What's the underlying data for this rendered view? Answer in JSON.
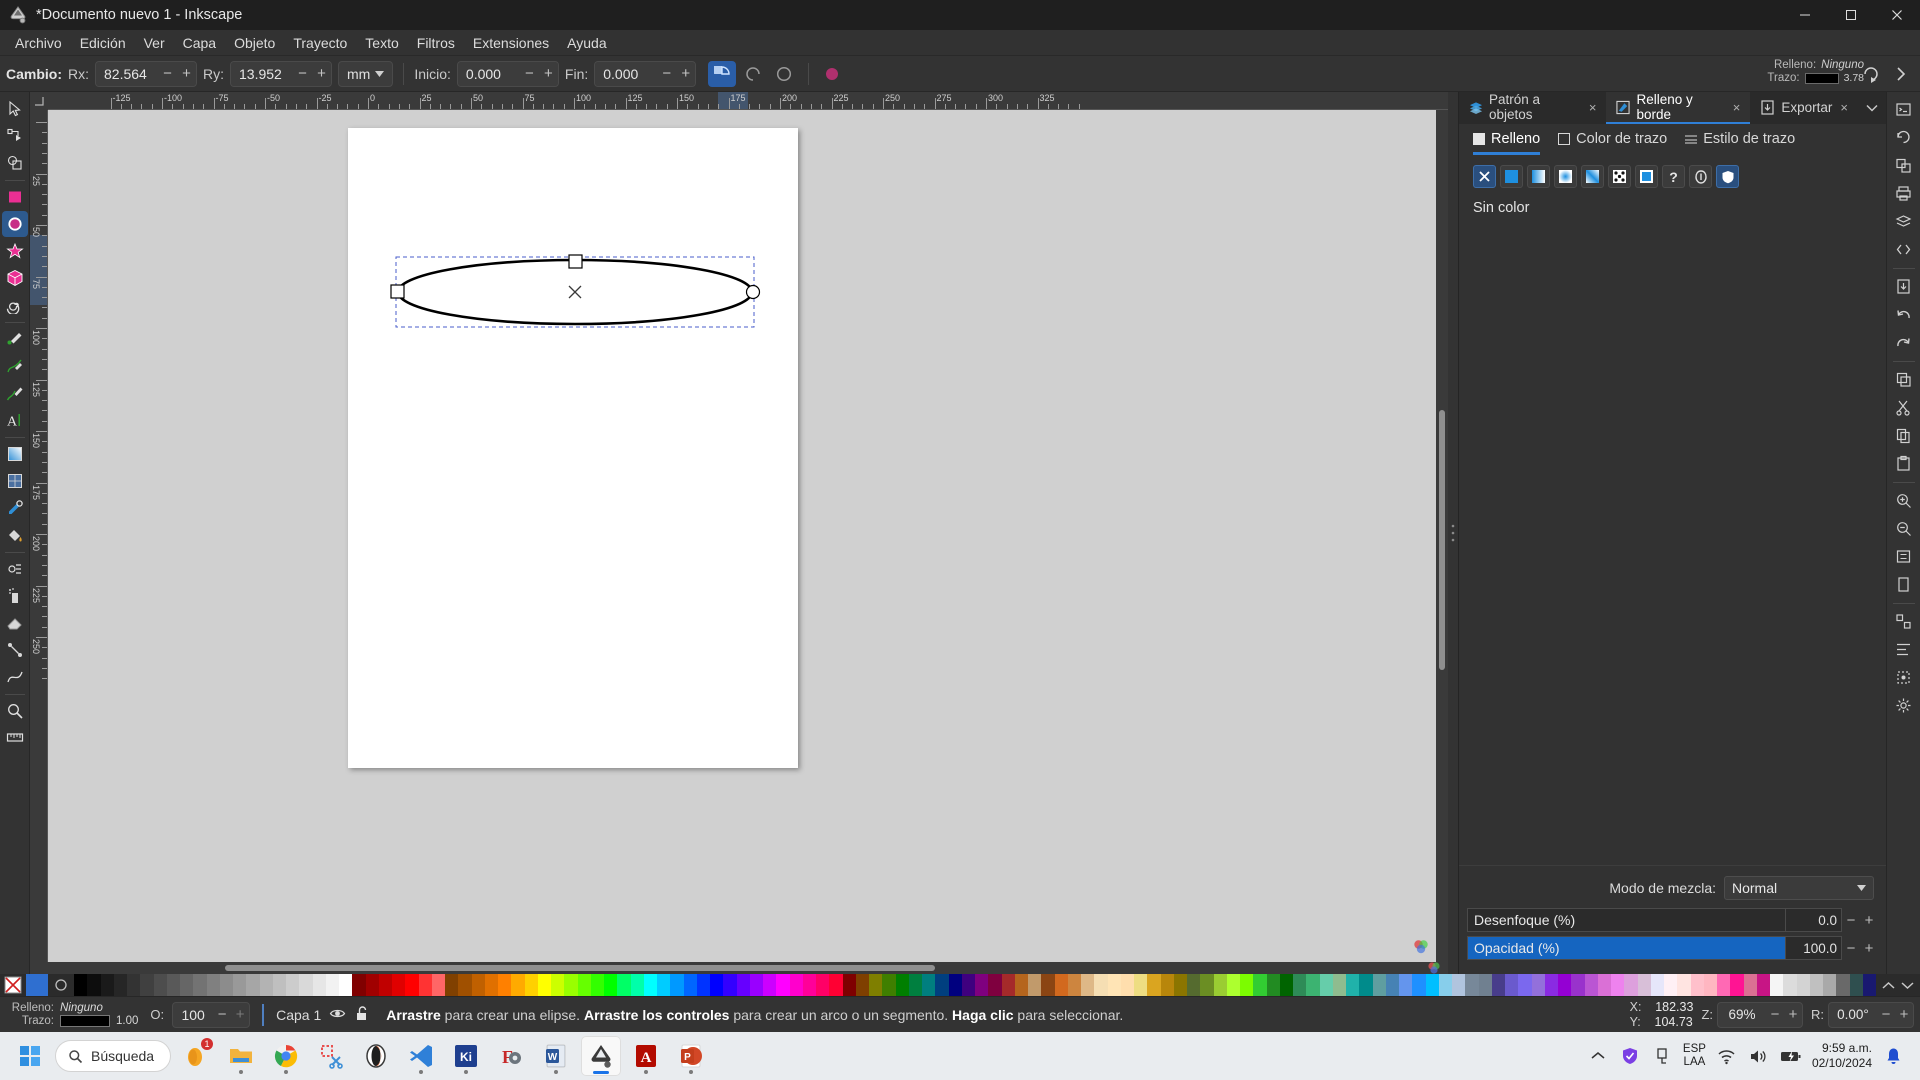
{
  "window": {
    "title": "*Documento nuevo 1 - Inkscape",
    "minimize": "minimize-icon",
    "maximize": "maximize-icon",
    "close": "close-icon"
  },
  "menu": {
    "items": [
      {
        "label": "Archivo"
      },
      {
        "label": "Edición"
      },
      {
        "label": "Ver"
      },
      {
        "label": "Capa"
      },
      {
        "label": "Objeto"
      },
      {
        "label": "Trayecto"
      },
      {
        "label": "Texto"
      },
      {
        "label": "Filtros"
      },
      {
        "label": "Extensiones"
      },
      {
        "label": "Ayuda"
      }
    ]
  },
  "toolopts": {
    "change_label": "Cambio:",
    "rx_label": "Rx:",
    "rx_value": "82.564",
    "ry_label": "Ry:",
    "ry_value": "13.952",
    "unit": "mm",
    "start_label": "Inicio:",
    "start_value": "0.000",
    "end_label": "Fin:",
    "end_value": "0.000",
    "minus": "−",
    "plus": "+",
    "modes": [
      {
        "name": "arc-slice-mode",
        "active": true
      },
      {
        "name": "arc-open-mode",
        "active": false
      },
      {
        "name": "ellipse-whole-mode",
        "active": false
      }
    ],
    "reset_button": "reset-shape-icon",
    "fill_label": "Relleno:",
    "fill_value": "Ninguno",
    "stroke_label": "Trazo:",
    "stroke_width": "3.78"
  },
  "toolbox": {
    "tools": [
      {
        "name": "selector-tool",
        "icon": "arrow-cursor-icon",
        "selected": false
      },
      {
        "name": "node-tool",
        "icon": "node-editor-icon",
        "selected": false
      },
      {
        "name": "boolean-tool",
        "icon": "boolean-ops-icon",
        "selected": false
      },
      {
        "name": "rectangle-tool",
        "icon": "rectangle-icon",
        "selected": false
      },
      {
        "name": "ellipse-tool",
        "icon": "ellipse-icon",
        "selected": true
      },
      {
        "name": "star-tool",
        "icon": "star-icon",
        "selected": false
      },
      {
        "name": "box3d-tool",
        "icon": "3d-box-icon",
        "selected": false
      },
      {
        "name": "spiral-tool",
        "icon": "spiral-icon",
        "selected": false
      },
      {
        "name": "pencil-tool",
        "icon": "pencil-icon",
        "selected": false
      },
      {
        "name": "pen-tool",
        "icon": "bezier-pen-icon",
        "selected": false
      },
      {
        "name": "calligraphy-tool",
        "icon": "calligraphy-brush-icon",
        "selected": false
      },
      {
        "name": "text-tool",
        "icon": "text-a-icon",
        "selected": false
      },
      {
        "name": "gradient-tool",
        "icon": "gradient-icon",
        "selected": false
      },
      {
        "name": "mesh-tool",
        "icon": "mesh-gradient-icon",
        "selected": false
      },
      {
        "name": "dropper-tool",
        "icon": "eyedropper-icon",
        "selected": false
      },
      {
        "name": "paintbucket-tool",
        "icon": "paint-bucket-icon",
        "selected": false
      },
      {
        "name": "tweak-tool",
        "icon": "tweak-icon",
        "selected": false
      },
      {
        "name": "spray-tool",
        "icon": "spray-can-icon",
        "selected": false
      },
      {
        "name": "eraser-tool",
        "icon": "eraser-icon",
        "selected": false
      },
      {
        "name": "connector-tool",
        "icon": "connector-icon",
        "selected": false
      },
      {
        "name": "lpe-tool",
        "icon": "path-effect-icon",
        "selected": false
      },
      {
        "name": "zoom-tool",
        "icon": "magnifier-icon",
        "selected": false
      },
      {
        "name": "measure-tool",
        "icon": "measure-ruler-icon",
        "selected": false
      }
    ]
  },
  "rulers": {
    "horizontal_labels": [
      "-125",
      "-100",
      "-75",
      "-50",
      "-25",
      "0",
      "25",
      "50",
      "75",
      "100",
      "125",
      "150",
      "175",
      "200",
      "225",
      "250",
      "275",
      "300",
      "325"
    ],
    "vertical_labels": [
      "0",
      "25",
      "50",
      "75",
      "100",
      "125",
      "150",
      "175",
      "200",
      "225",
      "250"
    ]
  },
  "canvas": {
    "shape": "ellipse",
    "selection_handles": [
      "top-center-square-handle",
      "left-square-handle",
      "right-round-handle"
    ],
    "center_marker": "x-cross-marker"
  },
  "panel": {
    "tabs": [
      {
        "label": "Patrón a objetos",
        "icon": "pattern-to-objects-icon",
        "active": false,
        "close": "×"
      },
      {
        "label": "Relleno y borde",
        "icon": "fill-stroke-icon",
        "active": true,
        "close": "×"
      },
      {
        "label": "Exportar",
        "icon": "export-icon",
        "active": false,
        "close": "×"
      }
    ],
    "overflow": "chevron-down-icon",
    "fs_tabs": [
      {
        "label": "Relleno",
        "icon": "fill-square-icon",
        "active": true
      },
      {
        "label": "Color de trazo",
        "icon": "stroke-square-icon",
        "active": false
      },
      {
        "label": "Estilo de trazo",
        "icon": "stroke-style-icon",
        "active": false
      }
    ],
    "paint_buttons": [
      {
        "name": "no-paint-button",
        "icon": "x-icon",
        "active": true
      },
      {
        "name": "flat-color-button",
        "icon": "flat-color-icon",
        "active": false
      },
      {
        "name": "linear-gradient-button",
        "icon": "linear-gradient-icon",
        "active": false
      },
      {
        "name": "radial-gradient-button",
        "icon": "radial-gradient-icon",
        "active": false
      },
      {
        "name": "mesh-gradient-button",
        "icon": "mesh-gradient-icon",
        "active": false
      },
      {
        "name": "pattern-button",
        "icon": "pattern-icon",
        "active": false
      },
      {
        "name": "swatch-button",
        "icon": "swatch-icon",
        "active": false
      },
      {
        "name": "unknown-paint-button",
        "icon": "question-mark-icon",
        "active": false
      },
      {
        "name": "unset-paint-button",
        "icon": "unset-paint-icon",
        "active": false
      },
      {
        "name": "paint-order-button",
        "icon": "shield-paint-icon",
        "active": false
      }
    ],
    "status_text": "Sin color",
    "blend_label": "Modo de mezcla:",
    "blend_value": "Normal",
    "blur_label": "Desenfoque (%)",
    "blur_value": "0.0",
    "opacity_label": "Opacidad (%)",
    "opacity_value": "100.0",
    "opacity_percent": 100,
    "minus": "−",
    "plus": "+"
  },
  "iconrail": {
    "tools": [
      {
        "name": "command-palette-icon"
      },
      {
        "name": "undo-history-icon"
      },
      {
        "name": "objects-icon"
      },
      {
        "name": "print-icon"
      },
      {
        "name": "layers-icon"
      },
      {
        "name": "xml-editor-icon"
      },
      {
        "name": "export-rail-icon"
      },
      {
        "name": "undo-rail-icon"
      },
      {
        "name": "redo-rail-icon"
      },
      {
        "name": "duplicate-icon"
      },
      {
        "name": "cut-icon"
      },
      {
        "name": "copy-icon"
      },
      {
        "name": "paste-icon"
      },
      {
        "name": "zoom-in-icon"
      },
      {
        "name": "zoom-out-icon"
      },
      {
        "name": "zoom-fit-icon"
      },
      {
        "name": "zoom-page-icon"
      },
      {
        "name": "group-icon"
      },
      {
        "name": "ungroup-icon"
      },
      {
        "name": "align-icon"
      },
      {
        "name": "transform-icon"
      },
      {
        "name": "settings-icon"
      }
    ]
  },
  "statusbar": {
    "fill_label": "Relleno:",
    "fill_value": "Ninguno",
    "stroke_label": "Trazo:",
    "stroke_width": "1.00",
    "opacity_label": "O:",
    "opacity_value": "100",
    "layer_name": "Capa 1",
    "layer_visibility_icon": "eye-icon",
    "layer_lock_icon": "unlock-icon",
    "message_parts": [
      {
        "text": "Arrastre",
        "bold": true
      },
      {
        "text": " para crear una elipse. ",
        "bold": false
      },
      {
        "text": "Arrastre los controles",
        "bold": true
      },
      {
        "text": " para crear un arco o un segmento. ",
        "bold": false
      },
      {
        "text": "Haga clic",
        "bold": true
      },
      {
        "text": " para seleccionar.",
        "bold": false
      }
    ],
    "x_label": "X:",
    "x_value": "182.33",
    "y_label": "Y:",
    "y_value": "104.73",
    "z_label": "Z:",
    "z_value": "69%",
    "r_label": "R:",
    "r_value": "0.00°",
    "minus": "−",
    "plus": "+"
  },
  "palette": {
    "none_swatch": "x-none-swatch",
    "colors": [
      "#000000",
      "#0d0d0d",
      "#1a1a1a",
      "#262626",
      "#333333",
      "#404040",
      "#4d4d4d",
      "#595959",
      "#666666",
      "#737373",
      "#808080",
      "#8c8c8c",
      "#999999",
      "#a6a6a6",
      "#b3b3b3",
      "#bfbfbf",
      "#cccccc",
      "#d9d9d9",
      "#e6e6e6",
      "#f2f2f2",
      "#ffffff",
      "#800000",
      "#a00000",
      "#c00000",
      "#e00000",
      "#ff0000",
      "#ff3333",
      "#ff6666",
      "#804000",
      "#a05000",
      "#c06000",
      "#e07000",
      "#ff8000",
      "#ffaa00",
      "#ffd000",
      "#ffff00",
      "#ccff00",
      "#99ff00",
      "#66ff00",
      "#33ff00",
      "#00ff00",
      "#00ff66",
      "#00ffaa",
      "#00ffff",
      "#00ccff",
      "#0099ff",
      "#0066ff",
      "#0033ff",
      "#0000ff",
      "#3300ff",
      "#6600ff",
      "#9900ff",
      "#cc00ff",
      "#ff00ff",
      "#ff00cc",
      "#ff0099",
      "#ff0066",
      "#ff0033",
      "#7f0000",
      "#7f3f00",
      "#7f7f00",
      "#3f7f00",
      "#007f00",
      "#007f3f",
      "#007f7f",
      "#003f7f",
      "#00007f",
      "#3f007f",
      "#7f007f",
      "#7f003f",
      "#a52a2a",
      "#b5651d",
      "#c19a6b",
      "#8b4513",
      "#d2691e",
      "#cd853f",
      "#deb887",
      "#f5deb3",
      "#ffe4b5",
      "#ffdead",
      "#eedd82",
      "#daa520",
      "#b8860b",
      "#8b7500",
      "#556b2f",
      "#6b8e23",
      "#9acd32",
      "#adff2f",
      "#7cfc00",
      "#32cd32",
      "#228b22",
      "#006400",
      "#2e8b57",
      "#3cb371",
      "#66cdaa",
      "#8fbc8f",
      "#20b2aa",
      "#008b8b",
      "#5f9ea0",
      "#4682b4",
      "#6495ed",
      "#1e90ff",
      "#00bfff",
      "#87ceeb",
      "#b0c4de",
      "#778899",
      "#708090",
      "#483d8b",
      "#6a5acd",
      "#7b68ee",
      "#9370db",
      "#8a2be2",
      "#9400d3",
      "#9932cc",
      "#ba55d3",
      "#da70d6",
      "#ee82ee",
      "#dda0dd",
      "#d8bfd8",
      "#e6e6fa",
      "#fff0f5",
      "#ffe4e1",
      "#ffc0cb",
      "#ffb6c1",
      "#ff69b4",
      "#ff1493",
      "#db7093",
      "#c71585",
      "#f5f5f5",
      "#dcdcdc",
      "#d3d3d3",
      "#c0c0c0",
      "#a9a9a9",
      "#696969",
      "#2f4f4f",
      "#191970"
    ],
    "scroll_up": "chevron-up-icon",
    "menu": "palette-menu-icon"
  },
  "taskbar": {
    "start": "windows-start-icon",
    "search_placeholder": "Búsqueda",
    "search_icon": "search-icon",
    "apps": [
      {
        "name": "antivirus-app",
        "badge": "1",
        "running": false
      },
      {
        "name": "file-explorer-app",
        "running": true
      },
      {
        "name": "chrome-app",
        "running": true
      },
      {
        "name": "snipping-tool-app",
        "running": false
      },
      {
        "name": "opera-app",
        "running": false
      },
      {
        "name": "vscode-app",
        "running": true
      },
      {
        "name": "kicad-app",
        "running": true
      },
      {
        "name": "freecad-app",
        "running": false
      },
      {
        "name": "word-app",
        "running": true
      },
      {
        "name": "inkscape-app",
        "running": true,
        "active": true
      },
      {
        "name": "acrobat-app",
        "running": true
      },
      {
        "name": "powerpoint-app",
        "running": true
      }
    ],
    "tray": {
      "chevron": "show-hidden-icons",
      "defender": "security-icon",
      "usb": "usb-icon",
      "lang_top": "ESP",
      "lang_bottom": "LAA",
      "wifi": "wifi-icon",
      "volume": "speaker-icon",
      "battery": "battery-icon",
      "time": "9:59 a.m.",
      "date": "02/10/2024",
      "notifications": "bell-icon"
    }
  }
}
